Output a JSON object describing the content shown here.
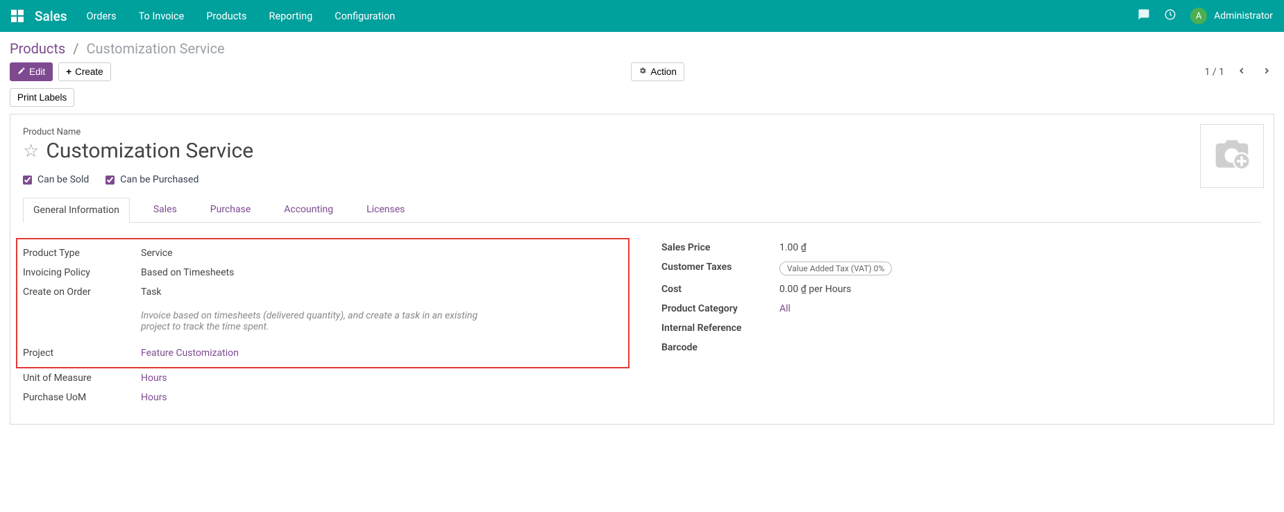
{
  "topbar": {
    "app_title": "Sales",
    "nav": [
      "Orders",
      "To Invoice",
      "Products",
      "Reporting",
      "Configuration"
    ],
    "user_initial": "A",
    "user_name": "Administrator"
  },
  "breadcrumb": {
    "parent": "Products",
    "current": "Customization Service"
  },
  "buttons": {
    "edit": "Edit",
    "create": "Create",
    "action": "Action",
    "print_labels": "Print Labels"
  },
  "pager": {
    "text": "1 / 1"
  },
  "product": {
    "name_label": "Product Name",
    "name": "Customization Service",
    "can_be_sold_label": "Can be Sold",
    "can_be_sold": true,
    "can_be_purchased_label": "Can be Purchased",
    "can_be_purchased": true
  },
  "tabs": [
    "General Information",
    "Sales",
    "Purchase",
    "Accounting",
    "Licenses"
  ],
  "fields_left": {
    "product_type_label": "Product Type",
    "product_type": "Service",
    "invoicing_policy_label": "Invoicing Policy",
    "invoicing_policy": "Based on Timesheets",
    "create_on_order_label": "Create on Order",
    "create_on_order": "Task",
    "help_text": "Invoice based on timesheets (delivered quantity), and create a task in an existing project to track the time spent.",
    "project_label": "Project",
    "project": "Feature Customization",
    "uom_label": "Unit of Measure",
    "uom": "Hours",
    "purchase_uom_label": "Purchase UoM",
    "purchase_uom": "Hours"
  },
  "fields_right": {
    "sales_price_label": "Sales Price",
    "sales_price": "1.00 ₫",
    "customer_taxes_label": "Customer Taxes",
    "customer_taxes": "Value Added Tax (VAT) 0%",
    "cost_label": "Cost",
    "cost": "0.00 ₫ per Hours",
    "category_label": "Product Category",
    "category": "All",
    "internal_ref_label": "Internal Reference",
    "internal_ref": "",
    "barcode_label": "Barcode",
    "barcode": ""
  }
}
